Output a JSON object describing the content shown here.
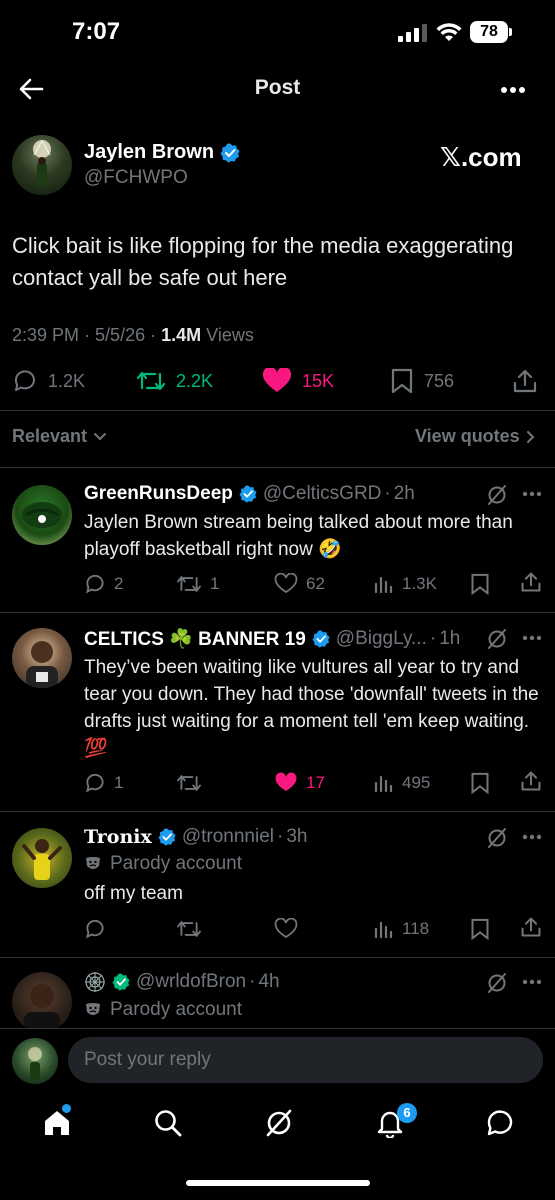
{
  "status_bar": {
    "time": "7:07",
    "battery": "78"
  },
  "header": {
    "title": "Post"
  },
  "post": {
    "author_name": "Jaylen Brown",
    "author_handle": "@FCHWPO",
    "source_logo": "𝕏.com",
    "text": "Click bait is like flopping for the media exaggerating contact yall be safe out here",
    "time": "2:39 PM",
    "date": "5/5/26",
    "views_count": "1.4M",
    "views_label": "Views",
    "replies": "1.2K",
    "reposts": "2.2K",
    "likes": "15K",
    "bookmarks": "756"
  },
  "filters": {
    "sort_label": "Relevant",
    "view_quotes_label": "View quotes"
  },
  "replies": [
    {
      "name": "GreenRunsDeep",
      "handle": "@CelticsGRD",
      "time": "2h",
      "text": "Jaylen Brown stream being talked about more than playoff basketball right now 🤣",
      "replies": "2",
      "reposts": "1",
      "likes": "62",
      "views": "1.3K"
    },
    {
      "name": "CELTICS ☘️ BANNER 19",
      "handle": "@BiggLy...",
      "time": "1h",
      "text": "They’ve been waiting like vultures all year to try and tear you down. They had those 'downfall' tweets in the drafts just waiting for a moment tell 'em keep waiting. 💯",
      "replies": "1",
      "reposts": "",
      "likes": "17",
      "views": "495"
    },
    {
      "name": "Tronix",
      "handle": "@tronnniel",
      "time": "3h",
      "parody": "Parody account",
      "text": "off my team",
      "replies": "",
      "reposts": "",
      "likes": "",
      "views": "118"
    },
    {
      "name": "",
      "handle": "@wrldofBron",
      "time": "4h",
      "parody": "Parody account"
    }
  ],
  "reply_bar": {
    "placeholder": "Post your reply"
  },
  "nav": {
    "notifications_badge": "6"
  },
  "colors": {
    "accent": "#1d9bf0",
    "repost": "#00ba7c",
    "like": "#f91880",
    "muted": "#71767b",
    "background": "#000000"
  }
}
